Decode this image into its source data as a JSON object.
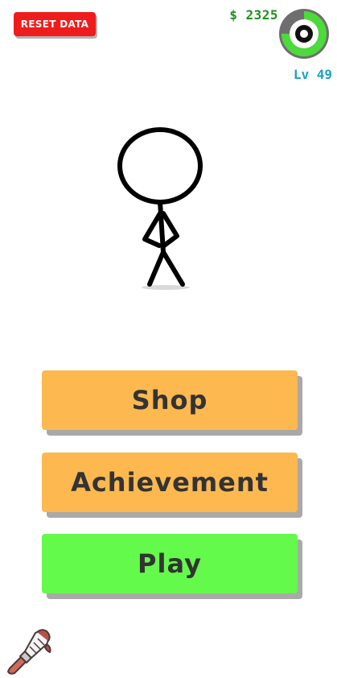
{
  "header": {
    "reset_label": "RESET DATA",
    "money": "$ 2325",
    "level": "Lv 49",
    "level_progress": 0.75
  },
  "menu": {
    "shop_label": "Shop",
    "achievement_label": "Achievement",
    "play_label": "Play"
  },
  "colors": {
    "reset": "#ef1c1c",
    "money": "#1f8f1f",
    "level_text": "#1aa3c4",
    "ring_progress": "#4cdb3a",
    "ring_track": "#777777",
    "menu_orange": "#fdb84f",
    "menu_green": "#63fa4b"
  },
  "icons": {
    "level_ring": "level-progress-ring",
    "character": "stickman",
    "customize": "paint-brush-icon"
  }
}
